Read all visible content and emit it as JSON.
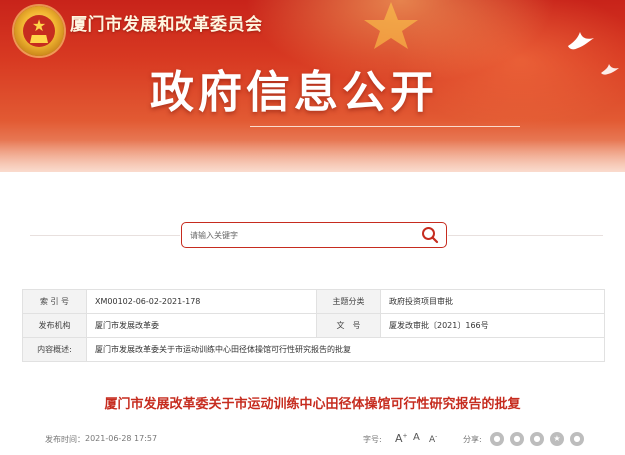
{
  "header": {
    "org_name": "厦门市发展和改革委员会",
    "page_heading": "政府信息公开",
    "banner_color": "#d83a22"
  },
  "search": {
    "placeholder": "请输入关键字"
  },
  "meta": {
    "index_label": "索 引 号",
    "index_value": "XM00102-06-02-2021-178",
    "category_label": "主题分类",
    "category_value": "政府投资项目审批",
    "issuer_label": "发布机构",
    "issuer_value": "厦门市发展改革委",
    "docno_label": "文　号",
    "docno_value": "厦发改审批〔2021〕166号",
    "summary_label": "内容概述:",
    "summary_value": "厦门市发展改革委关于市运动训练中心田径体操馆可行性研究报告的批复"
  },
  "document": {
    "title": "厦门市发展改革委关于市运动训练中心田径体操馆可行性研究报告的批复",
    "title_color": "#c62c1f",
    "publish_label": "发布时间：",
    "publish_date": "2021-06-28 17:57",
    "font_size_label": "字号:",
    "font_large": "A",
    "font_medium": "A",
    "font_small": "A",
    "share_label": "分享:",
    "share_icons": [
      "wechat-icon",
      "weibo-icon",
      "qq-icon",
      "qzone-icon",
      "douban-icon"
    ]
  }
}
